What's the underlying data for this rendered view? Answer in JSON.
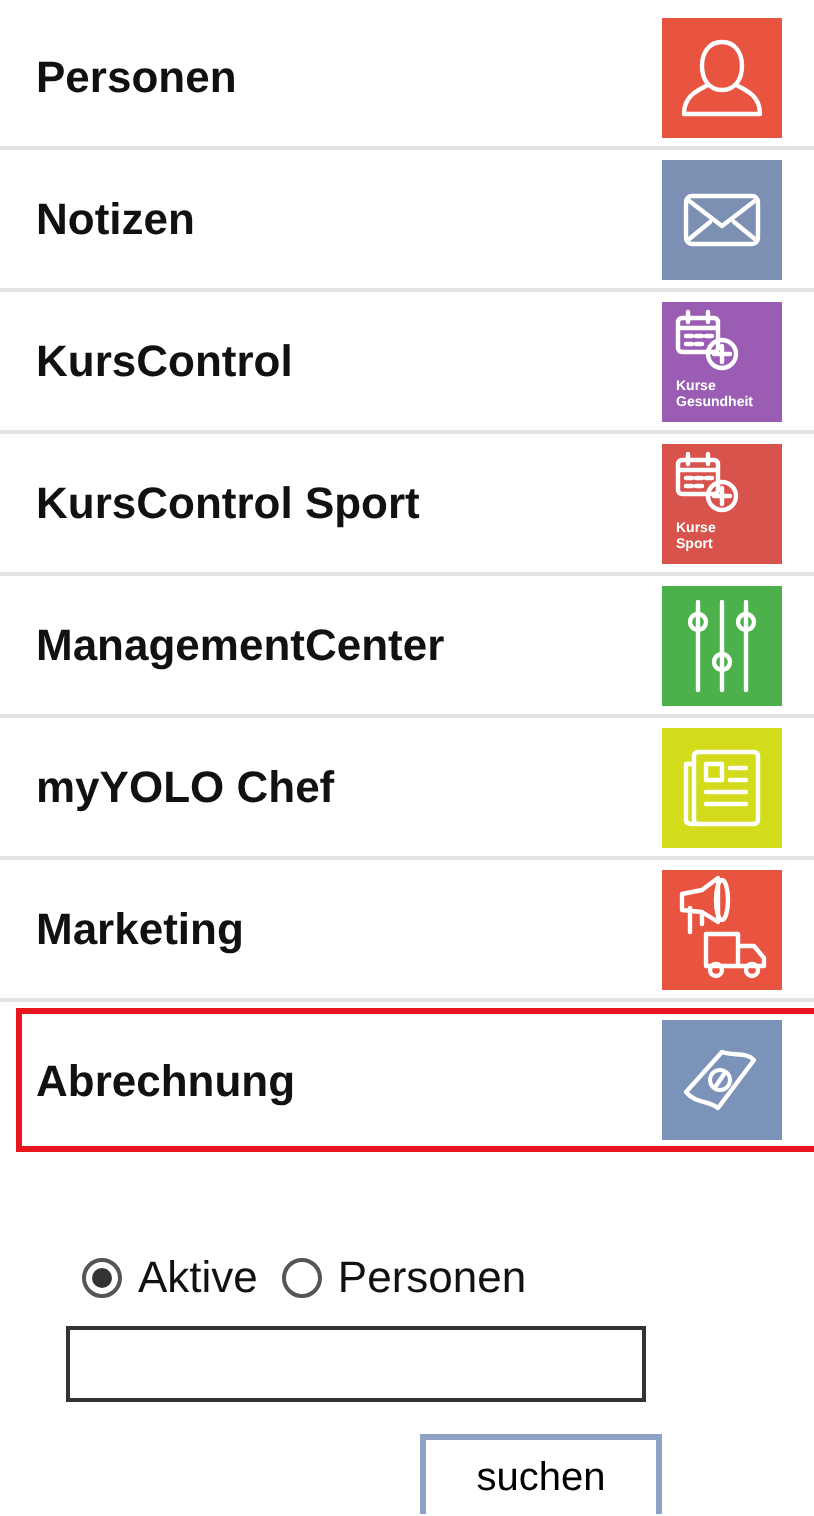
{
  "menu": [
    {
      "label": "Personen",
      "kind": "person",
      "color": "#e8543f",
      "selected": false
    },
    {
      "label": "Notizen",
      "kind": "envelope",
      "color": "#7b90b2",
      "selected": false
    },
    {
      "label": "KursControl",
      "kind": "calendar",
      "color": "#9a5db3",
      "caption": [
        "Kurse",
        "Gesundheit"
      ],
      "selected": false
    },
    {
      "label": "KursControl Sport",
      "kind": "calendar",
      "color": "#d7534c",
      "caption": [
        "Kurse",
        "Sport"
      ],
      "selected": false
    },
    {
      "label": "ManagementCenter",
      "kind": "sliders",
      "color": "#4cb14a",
      "selected": false
    },
    {
      "label": "myYOLO Chef",
      "kind": "newspaper",
      "color": "#d3dc1b",
      "selected": false
    },
    {
      "label": "Marketing",
      "kind": "megaphone",
      "color": "#e8543f",
      "selected": false
    },
    {
      "label": "Abrechnung",
      "kind": "money",
      "color": "#7b93b8",
      "selected": true
    }
  ],
  "search": {
    "options": [
      {
        "label": "Aktive",
        "selected": true
      },
      {
        "label": "Personen",
        "selected": false
      }
    ],
    "button": "suchen"
  }
}
